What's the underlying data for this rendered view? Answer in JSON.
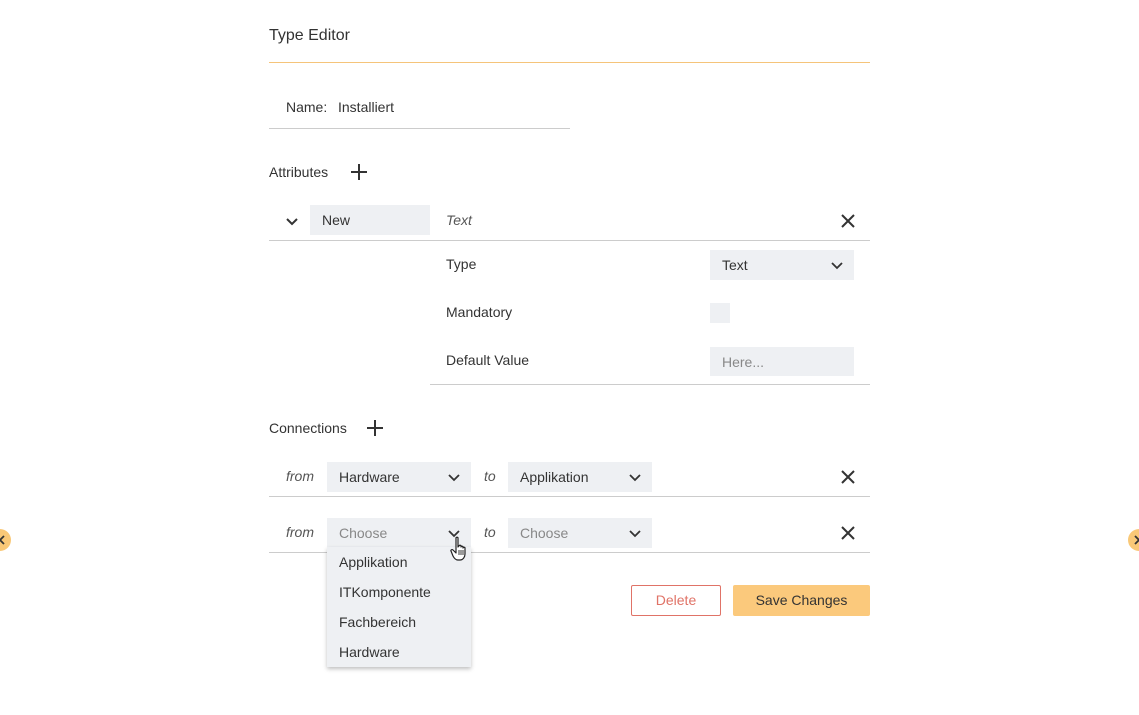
{
  "editor": {
    "title": "Type Editor",
    "name_label": "Name:",
    "name_value": "Installiert"
  },
  "attributes": {
    "section_label": "Attributes",
    "items": [
      {
        "name": "New",
        "type_display": "Text",
        "details": {
          "type_label": "Type",
          "type_value": "Text",
          "mandatory_label": "Mandatory",
          "mandatory_checked": false,
          "default_label": "Default Value",
          "default_placeholder": "Here..."
        }
      }
    ]
  },
  "connections": {
    "section_label": "Connections",
    "rows": [
      {
        "from_label": "from",
        "from_value": "Hardware",
        "to_label": "to",
        "to_value": "Applikation"
      },
      {
        "from_label": "from",
        "from_value": "Choose",
        "to_label": "to",
        "to_value": "Choose"
      }
    ],
    "open_dropdown_options": [
      "Applikation",
      "ITKomponente",
      "Fachbereich",
      "Hardware"
    ]
  },
  "actions": {
    "delete_label": "Delete",
    "save_label": "Save Changes"
  },
  "colors": {
    "accent": "#fbc97c",
    "accent_line": "#f5c47a",
    "danger": "#e07367",
    "field_bg": "#eef0f3"
  },
  "icons": {
    "add": "plus-icon",
    "collapse": "chevron-down-icon",
    "remove": "close-icon",
    "cursor": "hand-pointer-icon"
  }
}
